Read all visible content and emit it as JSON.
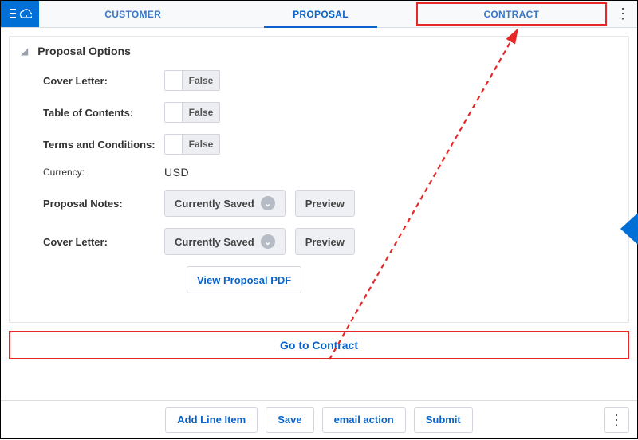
{
  "tabs": {
    "customer": "CUSTOMER",
    "proposal": "PROPOSAL",
    "contract": "CONTRACT"
  },
  "panel": {
    "title": "Proposal Options",
    "fields": {
      "cover_letter_label": "Cover Letter:",
      "cover_letter_value": "False",
      "toc_label": "Table of Contents:",
      "toc_value": "False",
      "terms_label": "Terms and Conditions:",
      "terms_value": "False",
      "currency_label": "Currency:",
      "currency_value": "USD",
      "notes_label": "Proposal Notes:",
      "notes_status": "Currently Saved",
      "notes_preview": "Preview",
      "cover_letter2_label": "Cover Letter:",
      "cover_letter2_status": "Currently Saved",
      "cover_letter2_preview": "Preview",
      "view_pdf": "View Proposal PDF"
    }
  },
  "go_to_contract": "Go to Contract",
  "bottom": {
    "add_line": "Add Line Item",
    "save": "Save",
    "email": "email action",
    "submit": "Submit"
  }
}
